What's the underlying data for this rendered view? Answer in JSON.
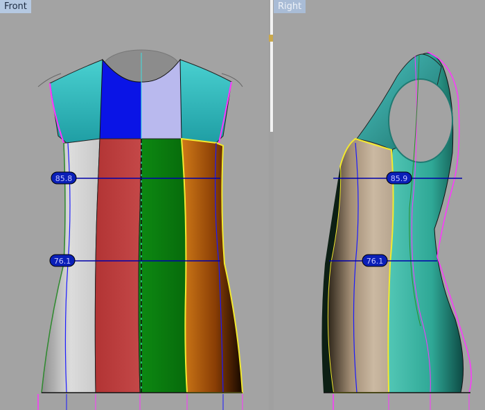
{
  "viewports": {
    "front": {
      "title": "Front"
    },
    "right": {
      "title": "Right"
    }
  },
  "measurements": {
    "front_bust": "85.8",
    "front_waist": "76.1",
    "right_bust": "85.9",
    "right_waist": "76.1"
  },
  "colors": {
    "background": "#a3a3a3",
    "measure_line": "#0000aa",
    "measure_badge": "#0a1fb8",
    "panel_cyan": "#3ec1c4",
    "panel_blue": "#0a14e6",
    "panel_lavender": "#b9b9ee",
    "panel_grey": "#cfcfcf",
    "panel_red": "#b83a3a",
    "panel_green": "#0b7f10",
    "panel_orange": "#c96b14",
    "panel_tan": "#b8a48c",
    "panel_teal": "#2fb8a8",
    "seam_yellow": "#f3ea2e",
    "seam_magenta": "#ff35ff"
  }
}
